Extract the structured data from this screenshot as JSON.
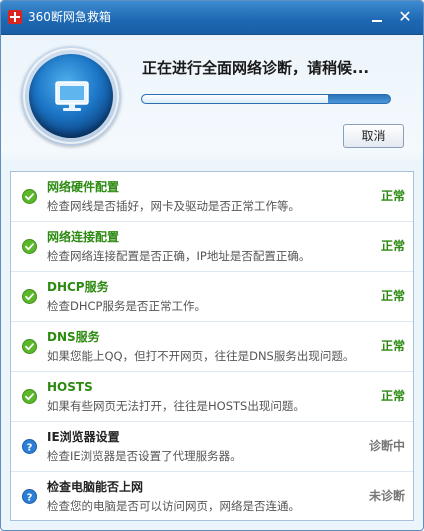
{
  "window": {
    "title": "360断网急救箱"
  },
  "header": {
    "status_text": "正在进行全面网络诊断，请稍候...",
    "progress": 0.75,
    "cancel_label": "取消"
  },
  "colors": {
    "ok_green": "#2c8a10",
    "pending_blue": "#1e6fc4",
    "title_dark": "#222222",
    "status_gray": "#777777",
    "titlebar_blue": "#1d67b2"
  },
  "checks": [
    {
      "title": "网络硬件配置",
      "desc": "检查网线是否插好，网卡及驱动是否正常工作等。",
      "status": "正常",
      "state": "ok"
    },
    {
      "title": "网络连接配置",
      "desc": "检查网络连接配置是否正确，IP地址是否配置正确。",
      "status": "正常",
      "state": "ok"
    },
    {
      "title": "DHCP服务",
      "desc": "检查DHCP服务是否正常工作。",
      "status": "正常",
      "state": "ok"
    },
    {
      "title": "DNS服务",
      "desc": "如果您能上QQ，但打不开网页，往往是DNS服务出现问题。",
      "status": "正常",
      "state": "ok"
    },
    {
      "title": "HOSTS",
      "desc": "如果有些网页无法打开，往往是HOSTS出现问题。",
      "status": "正常",
      "state": "ok"
    },
    {
      "title": "IE浏览器设置",
      "desc": "检查IE浏览器是否设置了代理服务器。",
      "status": "诊断中",
      "state": "pending"
    },
    {
      "title": "检查电脑能否上网",
      "desc": "检查您的电脑是否可以访问网页，网络是否连通。",
      "status": "未诊断",
      "state": "pending"
    }
  ]
}
